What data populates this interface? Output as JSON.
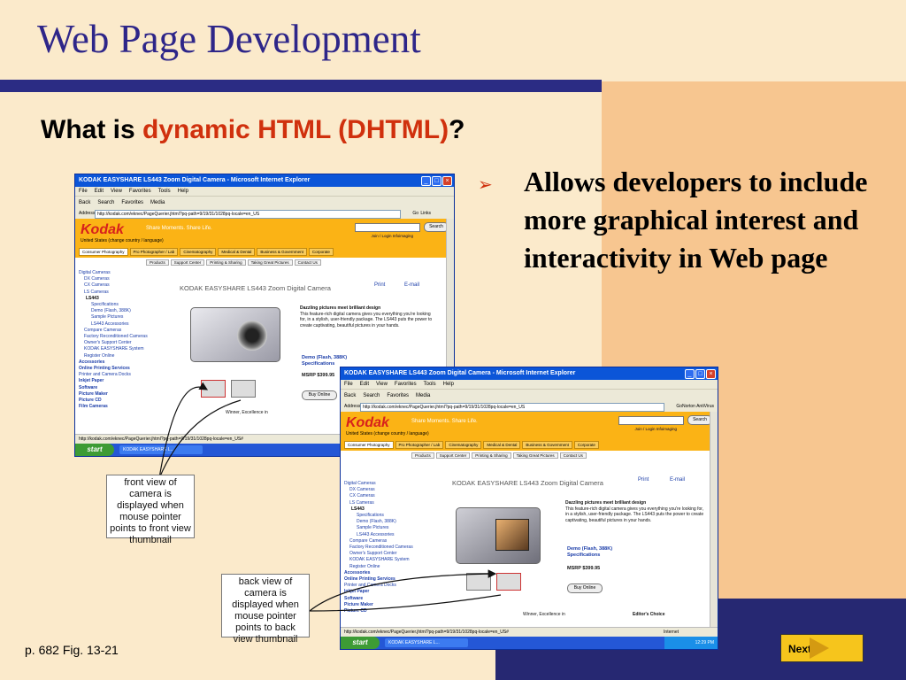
{
  "slide": {
    "title": "Web Page Development",
    "subtitle_prefix": "What is ",
    "subtitle_highlight": "dynamic HTML (DHTML",
    "subtitle_close_paren": ")",
    "subtitle_suffix": "?",
    "bullet_marker": "➢",
    "bullet_text": "Allows developers to include more graphical interest and interactivity in Web page",
    "caption": "p. 682 Fig. 13-21",
    "next_label": "Next",
    "colors": {
      "title": "#2e2689",
      "highlight": "#d0300d",
      "background": "#fbeacb",
      "accent_panel": "#f7c690",
      "band": "#262872"
    }
  },
  "callouts": {
    "front": "front view of camera is displayed when mouse pointer points to front view thumbnail",
    "back": "back view of camera is displayed when mouse pointer points to back view thumbnail"
  },
  "browser": {
    "window_title": "KODAK EASYSHARE LS443 Zoom Digital Camera - Microsoft Internet Explorer",
    "menu": [
      "File",
      "Edit",
      "View",
      "Favorites",
      "Tools",
      "Help"
    ],
    "toolbar": [
      "Back",
      "Search",
      "Favorites",
      "Media"
    ],
    "address_label": "Address",
    "address_value": "http://kodak.com/eknec/PageQuerier.jhtml?pq-path=9/19/31/1028pq-locale=en_US",
    "go_label": "Go",
    "links_label": "Links",
    "norton_label": "Norton AntiVirus",
    "logo": "Kodak",
    "tagline": "Share Moments. Share Life.",
    "country": "United States (change country / language)",
    "search_button": "Search",
    "join_links": "Join / Login  Infoimaging",
    "tabs": [
      "Consumer Photography",
      "Pro Photographer / Lab",
      "Cinematography",
      "Medical & Dental",
      "Business & Government",
      "Corporate"
    ],
    "subnav": [
      "Products",
      "Support Center",
      "Printing & Sharing",
      "Taking Great Pictures",
      "Contact Us"
    ],
    "left_nav": [
      "Digital Cameras",
      "DX Cameras",
      "CX Cameras",
      "LS Cameras",
      "LS443",
      "Specifications",
      "Demo (Flash, 388K)",
      "Sample Pictures",
      "LS443 Accessories",
      "Compare Cameras",
      "Factory Reconditioned Cameras",
      "Owner's Support Center",
      "KODAK EASYSHARE System",
      "Register Online",
      "Accessories",
      "Online Printing Services",
      "Printer and Camera Docks",
      "Inkjet Paper",
      "Software",
      "Picture Maker",
      "Picture CD",
      "Film Cameras"
    ],
    "page_title": "KODAK EASYSHARE LS443 Zoom Digital Camera",
    "print_label": "Print",
    "email_label": "E-mail",
    "desc_heading": "Dazzling pictures meet brilliant design",
    "desc_body": "This feature-rich digital camera gives you everything you're looking for, in a stylish, user-friendly package. The LS443 puts the power to create captivating, beautiful pictures in your hands.",
    "links": [
      "Demo (Flash, 388K)",
      "Specifications"
    ],
    "msrp": "MSRP $399.95",
    "buy_now": "Buy Online",
    "winner_text": "Winner, Excellence in",
    "editors_choice": "Editor's Choice",
    "status_url": "http://kodak.com/eknec/PageQuerier.jhtml?pq-path=9/19/31/1028pq-locale=en_US#",
    "status_zone": "Internet",
    "start_label": "start",
    "task_item": "KODAK EASYSHARE L...",
    "clock": "12:29 PM"
  }
}
